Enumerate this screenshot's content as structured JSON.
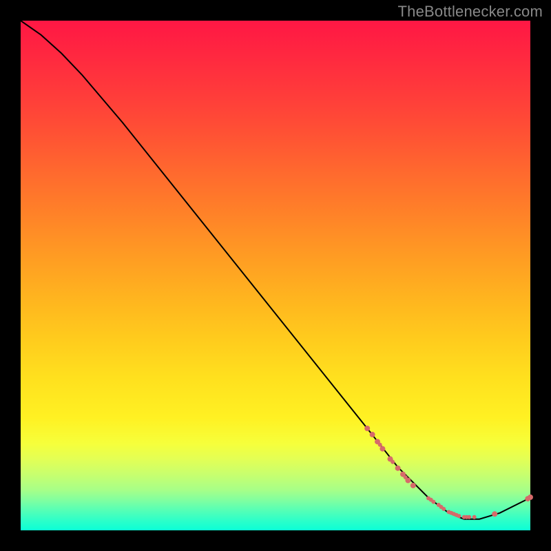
{
  "attribution": "TheBottlenecker.com",
  "chart_data": {
    "type": "line",
    "title": "",
    "xlabel": "",
    "ylabel": "",
    "xlim": [
      0,
      100
    ],
    "ylim": [
      0,
      100
    ],
    "grid": false,
    "line": [
      {
        "x": 0,
        "y": 100
      },
      {
        "x": 4,
        "y": 97.2
      },
      {
        "x": 8,
        "y": 93.6
      },
      {
        "x": 12,
        "y": 89.4
      },
      {
        "x": 20,
        "y": 80
      },
      {
        "x": 30,
        "y": 67.5
      },
      {
        "x": 40,
        "y": 55
      },
      {
        "x": 50,
        "y": 42.5
      },
      {
        "x": 60,
        "y": 30
      },
      {
        "x": 68,
        "y": 20
      },
      {
        "x": 74,
        "y": 12.4
      },
      {
        "x": 80,
        "y": 6.4
      },
      {
        "x": 84,
        "y": 3.4
      },
      {
        "x": 87,
        "y": 2.2
      },
      {
        "x": 90,
        "y": 2.2
      },
      {
        "x": 94,
        "y": 3.4
      },
      {
        "x": 100,
        "y": 6.4
      }
    ],
    "scatter": [
      {
        "x": 68,
        "y": 20.0,
        "r": 4
      },
      {
        "x": 69,
        "y": 18.8,
        "r": 4
      },
      {
        "x": 70,
        "y": 17.4,
        "r": 4
      },
      {
        "x": 70.5,
        "y": 16.8,
        "r": 3
      },
      {
        "x": 71,
        "y": 16.0,
        "r": 4
      },
      {
        "x": 72.5,
        "y": 14.0,
        "r": 4
      },
      {
        "x": 73,
        "y": 13.4,
        "r": 3
      },
      {
        "x": 74,
        "y": 12.2,
        "r": 4
      },
      {
        "x": 75,
        "y": 11.0,
        "r": 4
      },
      {
        "x": 75.5,
        "y": 10.4,
        "r": 3
      },
      {
        "x": 76,
        "y": 9.8,
        "r": 4
      },
      {
        "x": 77,
        "y": 8.8,
        "r": 4
      },
      {
        "x": 80,
        "y": 6.3,
        "r": 3
      },
      {
        "x": 80.5,
        "y": 6.0,
        "r": 3
      },
      {
        "x": 81,
        "y": 5.6,
        "r": 3
      },
      {
        "x": 82,
        "y": 5.0,
        "r": 3
      },
      {
        "x": 82.5,
        "y": 4.6,
        "r": 3
      },
      {
        "x": 83,
        "y": 4.2,
        "r": 3
      },
      {
        "x": 84,
        "y": 3.6,
        "r": 3
      },
      {
        "x": 84.5,
        "y": 3.4,
        "r": 3
      },
      {
        "x": 85,
        "y": 3.2,
        "r": 3
      },
      {
        "x": 85.5,
        "y": 3.0,
        "r": 3
      },
      {
        "x": 86,
        "y": 2.8,
        "r": 3
      },
      {
        "x": 87,
        "y": 2.6,
        "r": 3
      },
      {
        "x": 87.5,
        "y": 2.6,
        "r": 3
      },
      {
        "x": 88,
        "y": 2.6,
        "r": 3
      },
      {
        "x": 89,
        "y": 2.6,
        "r": 3
      },
      {
        "x": 93,
        "y": 3.2,
        "r": 4
      },
      {
        "x": 99.5,
        "y": 6.2,
        "r": 4
      },
      {
        "x": 100,
        "y": 6.5,
        "r": 4
      }
    ]
  }
}
